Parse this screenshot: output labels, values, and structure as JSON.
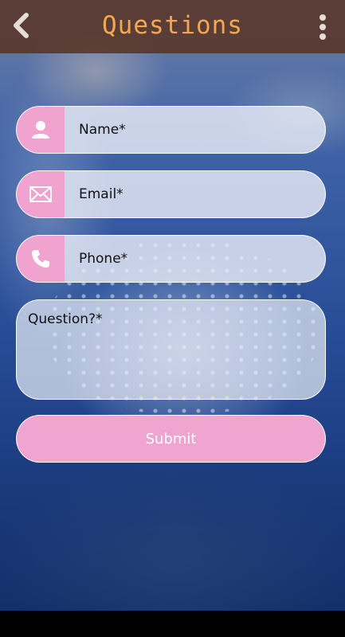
{
  "header": {
    "title": "Questions",
    "back_icon": "chevron-left-icon",
    "menu_icon": "more-vertical-icon",
    "color": "#f1a850"
  },
  "form": {
    "name_placeholder": "Name*",
    "email_placeholder": "Email*",
    "phone_placeholder": "Phone*",
    "question_placeholder": "Question?*",
    "submit_label": "Submit",
    "accent_color": "#f1a3cf"
  },
  "icons": {
    "name": "user-icon",
    "email": "envelope-icon",
    "phone": "phone-icon"
  }
}
